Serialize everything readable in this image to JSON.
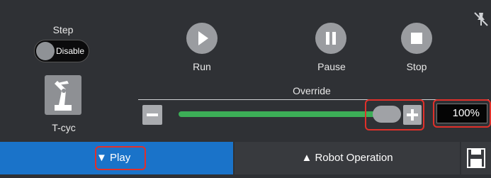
{
  "step": {
    "label": "Step",
    "toggle_text": "Disable"
  },
  "tcyc": {
    "label": "T-cyc"
  },
  "controls": {
    "run_label": "Run",
    "pause_label": "Pause",
    "stop_label": "Stop"
  },
  "override": {
    "label": "Override",
    "value_text": "100%",
    "value": 100
  },
  "footer": {
    "play_label": "▼ Play",
    "robot_operation_label": "▲ Robot Operation"
  },
  "colors": {
    "accent": "#1a73c9",
    "slider": "#3cae57",
    "highlight": "#e0302a"
  },
  "icons": {
    "pin": "pin-off-icon",
    "robot": "robot-arm-icon",
    "run": "play-circle-icon",
    "pause": "pause-circle-icon",
    "stop": "stop-circle-icon",
    "save": "save-icon"
  }
}
